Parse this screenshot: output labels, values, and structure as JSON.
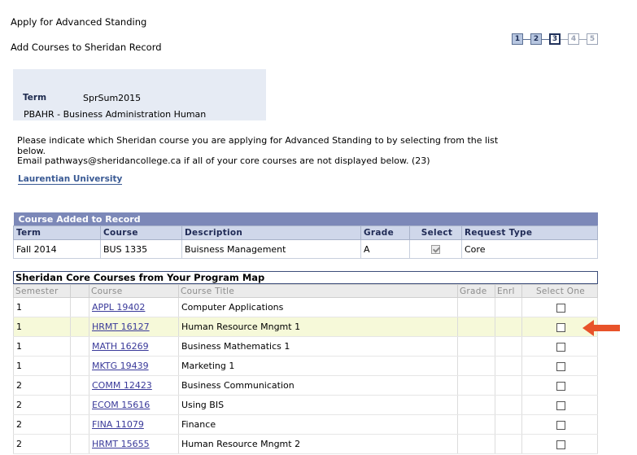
{
  "page": {
    "title": "Apply for Advanced Standing",
    "subtitle": "Add Courses to Sheridan Record"
  },
  "steps": [
    "1",
    "2",
    "3",
    "4",
    "5"
  ],
  "term": {
    "label": "Term",
    "value": "SprSum2015",
    "program": "PBAHR - Business Administration Human"
  },
  "instructions": {
    "line1": "Please indicate which Sheridan course you are applying for Advanced Standing to by selecting from the list below.",
    "line2": "Email pathways@sheridancollege.ca if all of your core courses are not displayed below. (23)"
  },
  "institution_link": "Laurentian University",
  "added_table": {
    "caption": "Course Added to Record",
    "headers": [
      "Term",
      "Course",
      "Description",
      "Grade",
      "Select",
      "Request Type"
    ],
    "rows": [
      {
        "term": "Fall 2014",
        "course": "BUS 1335",
        "description": "Buisness Management",
        "grade": "A",
        "selected": true,
        "request_type": "Core"
      }
    ]
  },
  "core_table": {
    "caption": "Sheridan Core Courses from Your Program Map",
    "headers": [
      "Semester",
      "",
      "Course",
      "Course Title",
      "Grade",
      "Enrl",
      "Select One"
    ],
    "rows": [
      {
        "semester": "1",
        "course": "APPL 19402",
        "title": "Computer Applications",
        "grade": "",
        "enrl": "",
        "selected": false
      },
      {
        "semester": "1",
        "course": "HRMT 16127",
        "title": "Human Resource Mngmt 1",
        "grade": "",
        "enrl": "",
        "selected": false,
        "highlighted": true
      },
      {
        "semester": "1",
        "course": "MATH 16269",
        "title": "Business Mathematics 1",
        "grade": "",
        "enrl": "",
        "selected": false
      },
      {
        "semester": "1",
        "course": "MKTG 19439",
        "title": "Marketing 1",
        "grade": "",
        "enrl": "",
        "selected": false
      },
      {
        "semester": "2",
        "course": "COMM 12423",
        "title": "Business Communication",
        "grade": "",
        "enrl": "",
        "selected": false
      },
      {
        "semester": "2",
        "course": "ECOM 15616",
        "title": "Using BIS",
        "grade": "",
        "enrl": "",
        "selected": false
      },
      {
        "semester": "2",
        "course": "FINA 11079",
        "title": "Finance",
        "grade": "",
        "enrl": "",
        "selected": false
      },
      {
        "semester": "2",
        "course": "HRMT 15655",
        "title": "Human Resource Mngmt 2",
        "grade": "",
        "enrl": "",
        "selected": false
      }
    ]
  },
  "colors": {
    "caption_bar": "#7c88b8",
    "header_bg": "#cfd7ea",
    "highlight_row": "#f6f9d9",
    "arrow": "#e8532a"
  },
  "icons": {
    "pointer": "left-arrow-icon"
  }
}
